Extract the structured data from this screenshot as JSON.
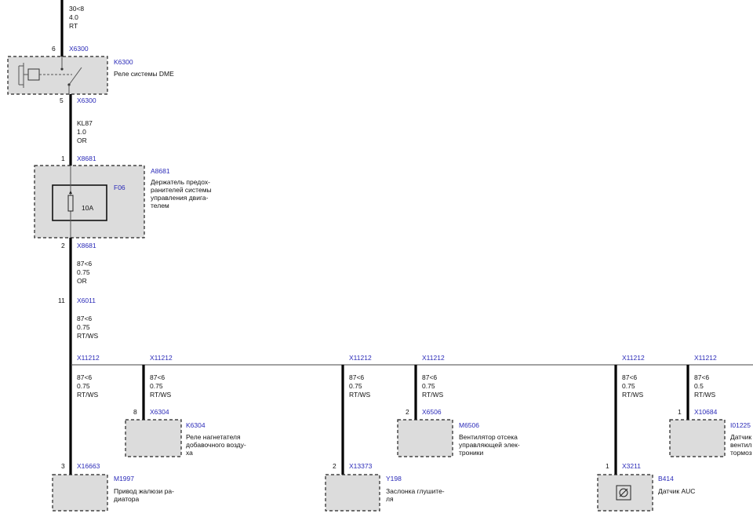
{
  "top_wire": {
    "signal": "30<8",
    "size": "4.0",
    "color": "RT"
  },
  "relay": {
    "pin_in": "6",
    "conn_in": "X6300",
    "id": "K6300",
    "name": "Реле системы DME",
    "pin_out": "5",
    "conn_out": "X6300"
  },
  "wire_kl87": {
    "signal": "KL87",
    "size": "1.0",
    "color": "OR"
  },
  "fuse_holder": {
    "pin_in": "1",
    "conn_in": "X8681",
    "id": "A8681",
    "name_lines": [
      "Держатель предох-",
      "ранителей системы",
      "управления двига-",
      "телем"
    ],
    "fuse_id": "F06",
    "fuse_rating": "10A",
    "pin_out": "2",
    "conn_out": "X8681"
  },
  "wire_fuse_out": {
    "signal": "87<6",
    "size": "0.75",
    "color": "OR"
  },
  "splice": {
    "pin": "11",
    "conn": "X6011"
  },
  "wire_bus": {
    "signal": "87<6",
    "size": "0.75",
    "color": "RT/WS"
  },
  "branches": [
    {
      "splice": "X11212",
      "signal": "87<6",
      "size": "0.75",
      "color": "RT/WS",
      "pin": "3",
      "conn": "X16663",
      "id": "M1997",
      "name_lines": [
        "Привод жалюзи ра-",
        "диатора"
      ]
    },
    {
      "splice": "X11212",
      "signal": "87<6",
      "size": "0.75",
      "color": "RT/WS",
      "pin": "8",
      "conn": "X6304",
      "id": "K6304",
      "name_lines": [
        "Реле нагнетателя",
        "добавочного возду-",
        "ха"
      ]
    },
    {
      "splice": "X11212",
      "signal": "87<6",
      "size": "0.75",
      "color": "RT/WS",
      "pin": "2",
      "conn": "X13373",
      "id": "Y198",
      "name_lines": [
        "Заслонка глушите-",
        "ля"
      ]
    },
    {
      "splice": "X11212",
      "signal": "87<6",
      "size": "0.75",
      "color": "RT/WS",
      "pin": "2",
      "conn": "X6506",
      "id": "M6506",
      "name_lines": [
        "Вентилятор отсека",
        "управляющей элек-",
        "троники"
      ]
    },
    {
      "splice": "X11212",
      "signal": "87<6",
      "size": "0.75",
      "color": "RT/WS",
      "pin": "1",
      "conn": "X3211",
      "id": "B414",
      "name_lines": [
        "Датчик AUC"
      ]
    },
    {
      "splice": "X11212",
      "signal": "87<6",
      "size": "0.5",
      "color": "RT/WS",
      "pin": "1",
      "conn": "X10684",
      "id": "I01225",
      "name_lines": [
        "Датчик",
        "вентил",
        "тормоз"
      ]
    }
  ],
  "colors": {
    "link": "#2a2ab8",
    "wire": "#000000",
    "box_fill": "#dcdcdc"
  }
}
